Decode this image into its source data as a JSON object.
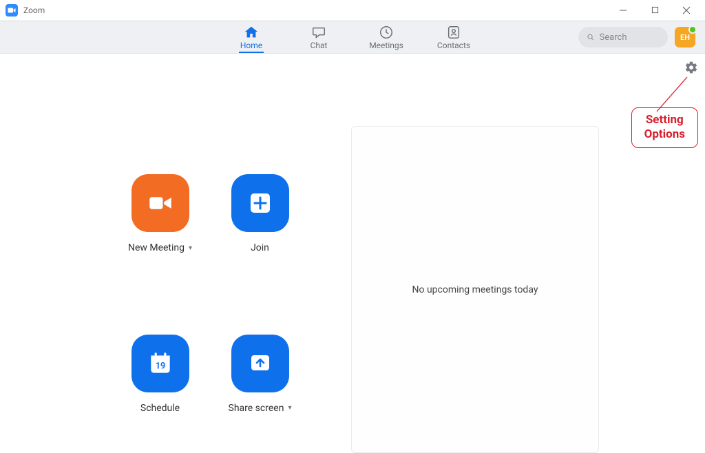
{
  "window": {
    "title": "Zoom"
  },
  "tabs": {
    "home": "Home",
    "chat": "Chat",
    "meetings": "Meetings",
    "contacts": "Contacts"
  },
  "search": {
    "placeholder": "Search"
  },
  "avatar": {
    "initials": "EH"
  },
  "actions": {
    "new_meeting": "New Meeting",
    "join": "Join",
    "schedule": "Schedule",
    "share_screen": "Share screen",
    "calendar_day": "19"
  },
  "panel": {
    "empty": "No upcoming meetings today"
  },
  "annotation": {
    "line1": "Setting",
    "line2": "Options"
  }
}
